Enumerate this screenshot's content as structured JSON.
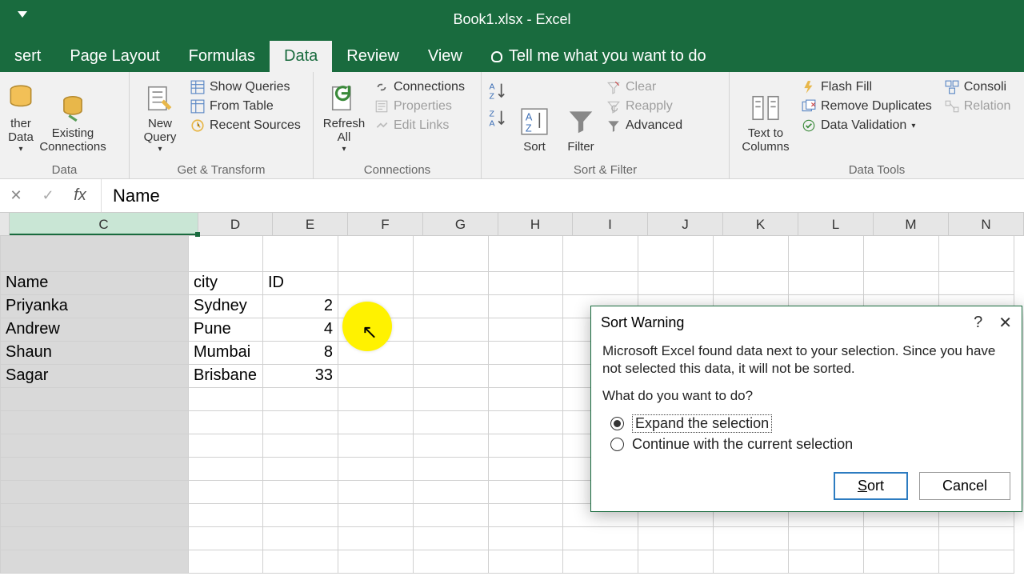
{
  "titlebar": {
    "title": "Book1.xlsx - Excel"
  },
  "tabs": {
    "insert": "sert",
    "page_layout": "Page Layout",
    "formulas": "Formulas",
    "data": "Data",
    "review": "Review",
    "view": "View",
    "tellme": "Tell me what you want to do"
  },
  "ribbon": {
    "other_data": "ther\nData",
    "existing_conn": "Existing\nConnections",
    "new_query": "New\nQuery",
    "show_queries": "Show Queries",
    "from_table": "From Table",
    "recent_sources": "Recent Sources",
    "refresh_all": "Refresh\nAll",
    "connections": "Connections",
    "properties": "Properties",
    "edit_links": "Edit Links",
    "sort": "Sort",
    "filter": "Filter",
    "clear": "Clear",
    "reapply": "Reapply",
    "advanced": "Advanced",
    "text_to_columns": "Text to\nColumns",
    "flash_fill": "Flash Fill",
    "remove_dup": "Remove Duplicates",
    "data_validation": "Data Validation",
    "consolidate": "Consoli",
    "relations": "Relation",
    "group_get_external": "Data",
    "group_get_transform": "Get & Transform",
    "group_connections": "Connections",
    "group_sort_filter": "Sort & Filter",
    "group_data_tools": "Data Tools"
  },
  "formula_bar": {
    "value": "Name"
  },
  "columns": [
    "C",
    "D",
    "E",
    "F",
    "G",
    "H",
    "I",
    "J",
    "K",
    "L",
    "M",
    "N"
  ],
  "sheet": {
    "headers": {
      "c": "Name",
      "d": "city",
      "e": "ID"
    },
    "rows": [
      {
        "c": "Priyanka",
        "d": "Sydney",
        "e": "2"
      },
      {
        "c": "Andrew",
        "d": "Pune",
        "e": "4"
      },
      {
        "c": "Shaun",
        "d": "Mumbai",
        "e": "8"
      },
      {
        "c": "Sagar",
        "d": "Brisbane",
        "e": "33"
      }
    ]
  },
  "dialog": {
    "title": "Sort Warning",
    "message": "Microsoft Excel found data next to your selection.  Since you have not selected this data, it will not be sorted.",
    "prompt": "What do you want to do?",
    "opt_expand": "Expand the selection",
    "opt_continue": "Continue with the current selection",
    "btn_sort": "Sort",
    "btn_cancel": "Cancel"
  }
}
